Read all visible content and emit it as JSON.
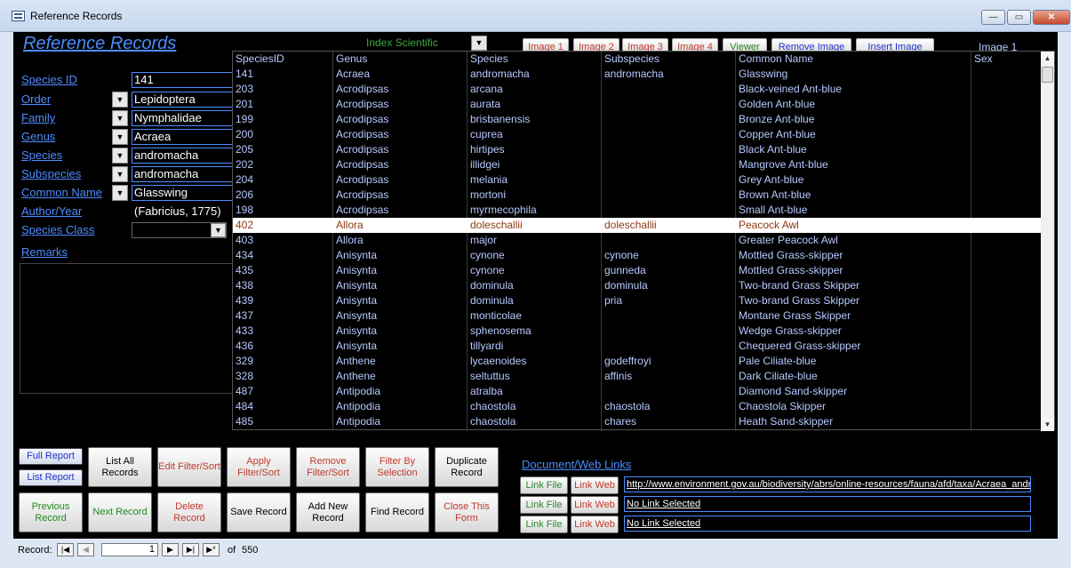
{
  "window": {
    "title": "Reference Records",
    "min": "—",
    "max": "▭",
    "close": "✕"
  },
  "form": {
    "title": "Reference Records",
    "index_label": "Index Scientific",
    "index_arrow": "▼"
  },
  "image_buttons": [
    "Image 1",
    "Image 2",
    "Image 3",
    "Image 4"
  ],
  "viewer_label": "Viewer",
  "remove_image_label": "Remove Image",
  "insert_image_label": "Insert Image",
  "image1_label": "Image 1",
  "fields": {
    "species_id": {
      "label": "Species ID",
      "value": "141"
    },
    "order": {
      "label": "Order",
      "value": "Lepidoptera"
    },
    "family": {
      "label": "Family",
      "value": "Nymphalidae"
    },
    "genus": {
      "label": "Genus",
      "value": "Acraea"
    },
    "species": {
      "label": "Species",
      "value": "andromacha"
    },
    "subspecies": {
      "label": "Subspecies",
      "value": "andromacha"
    },
    "common_name": {
      "label": "Common Name",
      "value": "Glasswing"
    },
    "author_year": {
      "label": "Author/Year",
      "value": "(Fabricius, 1775)"
    },
    "species_class": {
      "label": "Species Class",
      "value": ""
    },
    "remarks": {
      "label": "Remarks"
    }
  },
  "dropdown_arrow": "▼",
  "grid": {
    "headers": [
      "SpeciesID",
      "Genus",
      "Species",
      "Subspecies",
      "Common Name",
      "Sex"
    ],
    "rows": [
      [
        "141",
        "Acraea",
        "andromacha",
        "andromacha",
        "Glasswing"
      ],
      [
        "203",
        "Acrodipsas",
        "arcana",
        "",
        "Black-veined Ant-blue"
      ],
      [
        "201",
        "Acrodipsas",
        "aurata",
        "",
        "Golden Ant-blue"
      ],
      [
        "199",
        "Acrodipsas",
        "brisbanensis",
        "",
        "Bronze Ant-blue"
      ],
      [
        "200",
        "Acrodipsas",
        "cuprea",
        "",
        "Copper Ant-blue"
      ],
      [
        "205",
        "Acrodipsas",
        "hirtipes",
        "",
        "Black Ant-blue"
      ],
      [
        "202",
        "Acrodipsas",
        "illidgei",
        "",
        "Mangrove Ant-blue"
      ],
      [
        "204",
        "Acrodipsas",
        "melania",
        "",
        "Grey Ant-blue"
      ],
      [
        "206",
        "Acrodipsas",
        "mortoni",
        "",
        "Brown Ant-blue"
      ],
      [
        "198",
        "Acrodipsas",
        "myrmecophila",
        "",
        "Small Ant-blue"
      ],
      [
        "402",
        "Allora",
        "doleschallii",
        "doleschallii",
        "Peacock Awl"
      ],
      [
        "403",
        "Allora",
        "major",
        "",
        "Greater Peacock Awl"
      ],
      [
        "434",
        "Anisynta",
        "cynone",
        "cynone",
        "Mottled Grass-skipper"
      ],
      [
        "435",
        "Anisynta",
        "cynone",
        "gunneda",
        "Mottled Grass-skipper"
      ],
      [
        "438",
        "Anisynta",
        "dominula",
        "dominula",
        "Two-brand Grass Skipper"
      ],
      [
        "439",
        "Anisynta",
        "dominula",
        "pria",
        "Two-brand Grass Skipper"
      ],
      [
        "437",
        "Anisynta",
        "monticolae",
        "",
        "Montane Grass Skipper"
      ],
      [
        "433",
        "Anisynta",
        "sphenosema",
        "",
        "Wedge Grass-skipper"
      ],
      [
        "436",
        "Anisynta",
        "tillyardi",
        "",
        "Chequered Grass-skipper"
      ],
      [
        "329",
        "Anthene",
        "lycaenoides",
        "godeffroyi",
        "Pale Ciliate-blue"
      ],
      [
        "328",
        "Anthene",
        "seltuttus",
        "affinis",
        "Dark Ciliate-blue"
      ],
      [
        "487",
        "Antipodia",
        "atralba",
        "",
        "Diamond Sand-skipper"
      ],
      [
        "484",
        "Antipodia",
        "chaostola",
        "chaostola",
        "Chaostola Skipper"
      ],
      [
        "485",
        "Antipodia",
        "chaostola",
        "chares",
        "Heath Sand-skipper"
      ]
    ],
    "selected_row": 10,
    "scroll_up": "▲",
    "scroll_down": "▼"
  },
  "buttons": {
    "full_report": "Full Report",
    "list_report": "List Report",
    "list_all": "List All Records",
    "edit_filter": "Edit Filter/Sort",
    "apply_filter": "Apply Filter/Sort",
    "remove_filter": "Remove Filter/Sort",
    "filter_selection": "Filter By Selection",
    "duplicate": "Duplicate Record",
    "previous": "Previous Record",
    "next": "Next Record",
    "delete": "Delete Record",
    "save": "Save Record",
    "add_new": "Add New Record",
    "find": "Find Record",
    "close_form": "Close This Form"
  },
  "colors": {
    "blue": "#2233cc",
    "green": "#1f8a1f",
    "red": "#c0392b",
    "black": "#000000"
  },
  "links": {
    "title": "Document/Web Links",
    "link_file": "Link File",
    "link_web": "Link Web",
    "urls": [
      "http://www.environment.gov.au/biodiversity/abrs/online-resources/fauna/afd/taxa/Acraea_andromacha",
      "No Link Selected",
      "No Link Selected"
    ]
  },
  "navigation": {
    "record_label": "Record:",
    "current": "1",
    "of_label": "of",
    "total": "550",
    "first": "|◀",
    "prev": "◀",
    "next": "▶",
    "last": "▶|",
    "new": "▶*"
  }
}
